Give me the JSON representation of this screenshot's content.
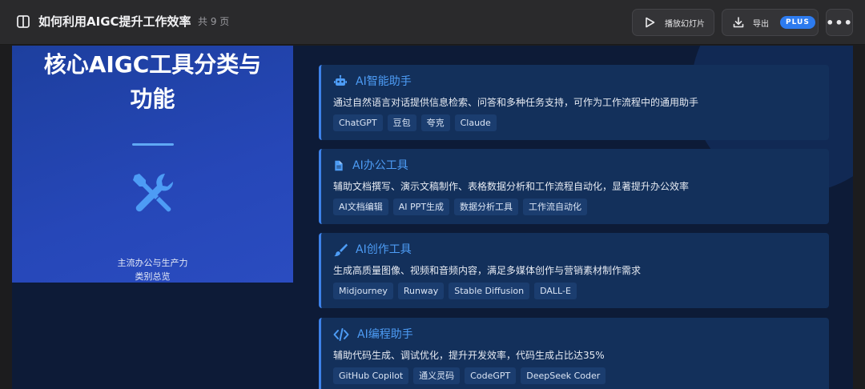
{
  "topbar": {
    "title": "如何利用AIGC提升工作效率",
    "pages": "共 9 页",
    "play_label": "播放幻灯片",
    "export_label": "导出",
    "plus_badge": "PLUS",
    "more_label": "•••"
  },
  "slide": {
    "title_line1": "核心AIGC工具分类与",
    "title_line2": "功能",
    "caption_line1": "主流办公与生产力",
    "caption_line2": "类别总览",
    "accent": "#4d9cf5",
    "cards": [
      {
        "icon": "robot-icon",
        "title": "AI智能助手",
        "desc": "通过自然语言对话提供信息检索、问答和多种任务支持，可作为工作流程中的通用助手",
        "tags": [
          "ChatGPT",
          "豆包",
          "夸克",
          "Claude"
        ]
      },
      {
        "icon": "document-icon",
        "title": "AI办公工具",
        "desc": "辅助文档撰写、演示文稿制作、表格数据分析和工作流程自动化，显著提升办公效率",
        "tags": [
          "AI文档编辑",
          "AI PPT生成",
          "数据分析工具",
          "工作流自动化"
        ]
      },
      {
        "icon": "paintbrush-icon",
        "title": "AI创作工具",
        "desc": "生成高质量图像、视频和音频内容，满足多媒体创作与营销素材制作需求",
        "tags": [
          "Midjourney",
          "Runway",
          "Stable Diffusion",
          "DALL-E"
        ]
      },
      {
        "icon": "code-icon",
        "title": "AI编程助手",
        "desc": "辅助代码生成、调试优化，提升开发效率，代码生成占比达35%",
        "tags": [
          "GitHub Copilot",
          "通义灵码",
          "CodeGPT",
          "DeepSeek Coder"
        ]
      }
    ]
  }
}
